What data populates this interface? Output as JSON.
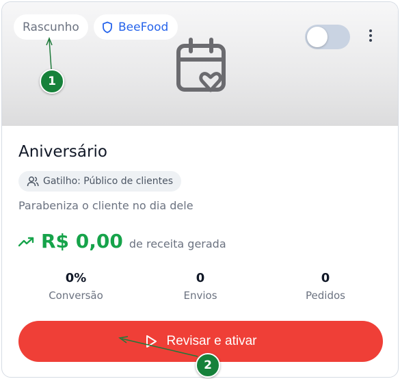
{
  "badges": {
    "status": "Rascunho",
    "brand": "BeeFood"
  },
  "toggle": {
    "on": false
  },
  "campaign": {
    "title": "Aniversário",
    "trigger": "Gatilho: Público de clientes",
    "description": "Parabeniza o cliente no dia dele"
  },
  "revenue": {
    "value": "R$ 0,00",
    "label": "de receita gerada"
  },
  "stats": [
    {
      "value": "0%",
      "label": "Conversão"
    },
    {
      "value": "0",
      "label": "Envios"
    },
    {
      "value": "0",
      "label": "Pedidos"
    }
  ],
  "cta": {
    "label": "Revisar e ativar"
  },
  "annotations": {
    "marker_1": "1",
    "marker_2": "2"
  },
  "colors": {
    "accent": "#ef3f37",
    "positive": "#16a34a",
    "brand": "#2563eb",
    "marker": "#16813a"
  },
  "icons": {
    "brand": "shield-icon",
    "banner": "calendar-heart-icon",
    "trigger": "users-icon",
    "revenue": "trending-up-icon",
    "cta": "play-icon",
    "menu": "kebab-menu-icon"
  }
}
